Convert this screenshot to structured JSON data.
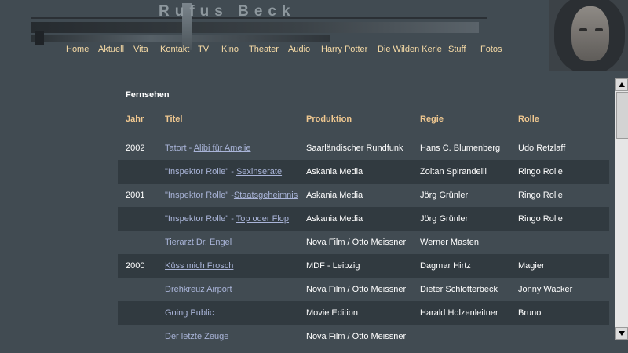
{
  "header": {
    "logo_text": "Rufus Beck"
  },
  "nav": {
    "items": [
      {
        "label": "Home"
      },
      {
        "label": "Aktuell"
      },
      {
        "label": "Vita"
      },
      {
        "label": "Kontakt"
      },
      {
        "label": "TV"
      },
      {
        "label": "Kino"
      },
      {
        "label": "Theater"
      },
      {
        "label": "Audio"
      },
      {
        "label": "Harry Potter"
      },
      {
        "label": "Die Wilden Kerle"
      },
      {
        "label": "Stuff"
      },
      {
        "label": "Fotos"
      }
    ]
  },
  "main": {
    "section_title": "Fernsehen",
    "columns": [
      "Jahr",
      "Titel",
      "Produktion",
      "Regie",
      "Rolle"
    ],
    "rows": [
      {
        "jahr": "2002",
        "titel_prefix": "Tatort - ",
        "titel_link": "Alibi für Amelie",
        "produktion": "Saarländischer Rundfunk",
        "regie": "Hans C. Blumenberg",
        "rolle": "Udo Retzlaff"
      },
      {
        "jahr": "",
        "titel_prefix": "\"Inspektor Rolle\" - ",
        "titel_link": "Sexinserate",
        "produktion": "Askania Media",
        "regie": "Zoltan Spirandelli",
        "rolle": "Ringo Rolle"
      },
      {
        "jahr": "2001",
        "titel_prefix": "\"Inspektor Rolle\" -",
        "titel_link": "Staatsgeheimnis",
        "produktion": "Askania Media",
        "regie": "Jörg Grünler",
        "rolle": "Ringo Rolle"
      },
      {
        "jahr": "",
        "titel_prefix": "\"Inspektor Rolle\" - ",
        "titel_link": "Top oder Flop",
        "produktion": "Askania Media",
        "regie": "Jörg Grünler",
        "rolle": "Ringo Rolle"
      },
      {
        "jahr": "",
        "titel_prefix": "Tierarzt Dr. Engel",
        "titel_link": "",
        "produktion": "Nova Film / Otto Meissner",
        "regie": "Werner Masten",
        "rolle": ""
      },
      {
        "jahr": "2000",
        "titel_prefix": "",
        "titel_link": "Küss mich Frosch",
        "produktion": "MDF - Leipzig",
        "regie": "Dagmar Hirtz",
        "rolle": "Magier"
      },
      {
        "jahr": "",
        "titel_prefix": "Drehkreuz Airport",
        "titel_link": "",
        "produktion": "Nova Film / Otto Meissner",
        "regie": "Dieter Schlotterbeck",
        "rolle": "Jonny Wacker"
      },
      {
        "jahr": "",
        "titel_prefix": "Going Public",
        "titel_link": "",
        "produktion": "Movie Edition",
        "regie": "Harald Holzenleitner",
        "rolle": "Bruno"
      },
      {
        "jahr": "",
        "titel_prefix": "Der letzte Zeuge",
        "titel_link": "",
        "produktion": "Nova Film / Otto Meissner",
        "regie": "",
        "rolle": ""
      }
    ]
  },
  "colors": {
    "background": "#414b52",
    "nav_text": "#f7dba6",
    "column_header": "#f0c890",
    "link": "#a9b4d8",
    "row_alt": "#313a40"
  }
}
